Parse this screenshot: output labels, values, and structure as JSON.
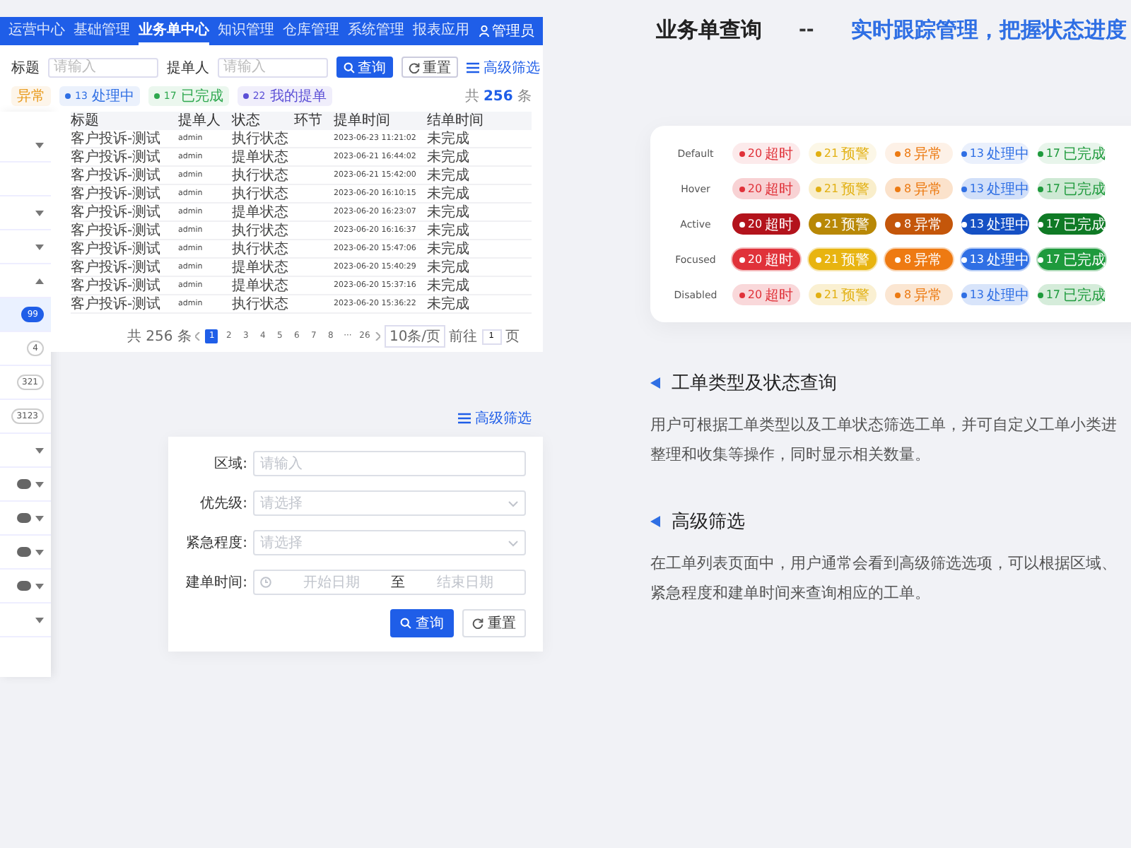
{
  "app": {
    "nav": [
      {
        "label": "运营中心",
        "selected": false
      },
      {
        "label": "基础管理",
        "selected": false
      },
      {
        "label": "业务单中心",
        "selected": true
      },
      {
        "label": "知识管理",
        "selected": false
      },
      {
        "label": "仓库管理",
        "selected": false
      },
      {
        "label": "系统管理",
        "selected": false
      },
      {
        "label": "报表应用",
        "selected": false
      }
    ],
    "user": "管理员",
    "filters": [
      {
        "label": "标题",
        "placeholder": "请输入"
      },
      {
        "label": "提单人",
        "placeholder": "请输入"
      }
    ],
    "search_button": "查询",
    "reset_button": "重置",
    "advanced_link": "高级筛选",
    "status_tabs": [
      {
        "label": "异常",
        "color": "#e89a1c"
      },
      {
        "label": "处理中",
        "count": "13",
        "color": "#2f6fe4"
      },
      {
        "label": "已完成",
        "count": "17",
        "color": "#2fa84f"
      },
      {
        "label": "我的提单",
        "count": "22",
        "color": "#5b4fd6"
      }
    ],
    "total": {
      "prefix": "共",
      "count": "256",
      "suffix": "条"
    },
    "sidebar": [
      {
        "kind": "chevron",
        "expanded": false
      },
      {
        "kind": "plain"
      },
      {
        "kind": "chevron",
        "expanded": false
      },
      {
        "kind": "chevron",
        "expanded": false
      },
      {
        "kind": "chevron",
        "expanded": true
      },
      {
        "kind": "count",
        "badge": "99",
        "selected": true
      },
      {
        "kind": "count",
        "badge": "4",
        "selected": false
      },
      {
        "kind": "count",
        "badge": "321",
        "selected": false
      },
      {
        "kind": "count",
        "badge": "3123",
        "selected": false
      },
      {
        "kind": "chevron",
        "expanded": false
      },
      {
        "kind": "dark",
        "expanded": false
      },
      {
        "kind": "dark",
        "expanded": false
      },
      {
        "kind": "dark",
        "expanded": false
      },
      {
        "kind": "dark",
        "expanded": false
      },
      {
        "kind": "chevron",
        "expanded": false
      }
    ],
    "table": {
      "columns": [
        "标题",
        "提单人",
        "状态",
        "环节",
        "提单时间",
        "结单时间"
      ],
      "rows": [
        [
          "客户投诉-测试",
          "admin",
          "执行状态",
          "",
          "2023-06-23 11:21:02",
          "未完成"
        ],
        [
          "客户投诉-测试",
          "admin",
          "提单状态",
          "",
          "2023-06-21 16:44:02",
          "未完成"
        ],
        [
          "客户投诉-测试",
          "admin",
          "执行状态",
          "",
          "2023-06-21 15:42:00",
          "未完成"
        ],
        [
          "客户投诉-测试",
          "admin",
          "执行状态",
          "",
          "2023-06-20 16:10:15",
          "未完成"
        ],
        [
          "客户投诉-测试",
          "admin",
          "提单状态",
          "",
          "2023-06-20 16:23:07",
          "未完成"
        ],
        [
          "客户投诉-测试",
          "admin",
          "执行状态",
          "",
          "2023-06-20 16:16:37",
          "未完成"
        ],
        [
          "客户投诉-测试",
          "admin",
          "执行状态",
          "",
          "2023-06-20 15:47:06",
          "未完成"
        ],
        [
          "客户投诉-测试",
          "admin",
          "提单状态",
          "",
          "2023-06-20 15:40:29",
          "未完成"
        ],
        [
          "客户投诉-测试",
          "admin",
          "提单状态",
          "",
          "2023-06-20 15:37:16",
          "未完成"
        ],
        [
          "客户投诉-测试",
          "admin",
          "执行状态",
          "",
          "2023-06-20 15:36:22",
          "未完成"
        ]
      ]
    },
    "pagination": {
      "total": "共 256 条",
      "pages": [
        {
          "label": "1",
          "selected": true
        },
        {
          "label": "2",
          "selected": false
        },
        {
          "label": "3",
          "selected": false
        },
        {
          "label": "4",
          "selected": false
        },
        {
          "label": "5",
          "selected": false
        },
        {
          "label": "6",
          "selected": false
        },
        {
          "label": "7",
          "selected": false
        },
        {
          "label": "8",
          "selected": false
        },
        {
          "label": "···",
          "selected": false
        },
        {
          "label": "26",
          "selected": false
        }
      ],
      "size": "10条/页",
      "goto": "前往",
      "page_input": "1",
      "page_unit": "页"
    }
  },
  "filter_panel": {
    "link": "高级筛选",
    "fields": [
      {
        "label": "区域:",
        "kind": "input",
        "placeholder": "请输入"
      },
      {
        "label": "优先级:",
        "kind": "select",
        "placeholder": "请选择"
      },
      {
        "label": "紧急程度:",
        "kind": "select",
        "placeholder": "请选择"
      },
      {
        "label": "建单时间:",
        "kind": "daterange",
        "start": "开始日期",
        "separator": "至",
        "end": "结束日期"
      }
    ],
    "buttons": [
      {
        "label": "查询",
        "kind": "primary"
      },
      {
        "label": "重置",
        "kind": "secondary"
      }
    ]
  },
  "heading": {
    "title": "业务单查询",
    "dash": "--",
    "subtitle": "实时跟踪管理，把握状态进度"
  },
  "states": [
    {
      "label": "Default",
      "kind": "default",
      "tags": [
        {
          "count": "20",
          "label": "超时",
          "color": "#e0323a"
        },
        {
          "count": "21",
          "label": "预警",
          "color": "#e2b012"
        },
        {
          "count": "8",
          "label": "异常",
          "color": "#ec7a12"
        },
        {
          "count": "13",
          "label": "处理中",
          "color": "#2f6fe4"
        },
        {
          "count": "17",
          "label": "已完成",
          "color": "#1e9a3c"
        }
      ]
    },
    {
      "label": "Hover",
      "kind": "hover",
      "tags": [
        {
          "count": "20",
          "label": "超时",
          "color": "#e0323a"
        },
        {
          "count": "21",
          "label": "预警",
          "color": "#e2b012"
        },
        {
          "count": "8",
          "label": "异常",
          "color": "#ec7a12"
        },
        {
          "count": "13",
          "label": "处理中",
          "color": "#2f6fe4"
        },
        {
          "count": "17",
          "label": "已完成",
          "color": "#1e9a3c"
        }
      ]
    },
    {
      "label": "Active",
      "kind": "active",
      "tags": [
        {
          "count": "20",
          "label": "超时",
          "color": "#b3131c"
        },
        {
          "count": "21",
          "label": "预警",
          "color": "#b88806"
        },
        {
          "count": "8",
          "label": "异常",
          "color": "#c4560a"
        },
        {
          "count": "13",
          "label": "处理中",
          "color": "#1550c4"
        },
        {
          "count": "17",
          "label": "已完成",
          "color": "#0f7a25"
        }
      ]
    },
    {
      "label": "Focused",
      "kind": "focused",
      "tags": [
        {
          "count": "20",
          "label": "超时",
          "color": "#e0323a"
        },
        {
          "count": "21",
          "label": "预警",
          "color": "#e8b410"
        },
        {
          "count": "8",
          "label": "异常",
          "color": "#ee7a12"
        },
        {
          "count": "13",
          "label": "处理中",
          "color": "#2f6fe4"
        },
        {
          "count": "17",
          "label": "已完成",
          "color": "#1e9a3c"
        }
      ]
    },
    {
      "label": "Disabled",
      "kind": "disabled",
      "tags": [
        {
          "count": "20",
          "label": "超时",
          "color": "#e0323a"
        },
        {
          "count": "21",
          "label": "预警",
          "color": "#e2b012"
        },
        {
          "count": "8",
          "label": "异常",
          "color": "#ec7a12"
        },
        {
          "count": "13",
          "label": "处理中",
          "color": "#2f6fe4"
        },
        {
          "count": "17",
          "label": "已完成",
          "color": "#1e9a3c"
        }
      ]
    }
  ],
  "sections": [
    {
      "title": "工单类型及状态查询",
      "lines": [
        "用户可根据工单类型以及工单状态筛选工单，并可自定义工单小类进",
        "整理和收集等操作，同时显示相关数量。"
      ]
    },
    {
      "title": "高级筛选",
      "lines": [
        "在工单列表页面中，用户通常会看到高级筛选选项，可以根据区域、",
        "紧急程度和建单时间来查询相应的工单。"
      ]
    }
  ]
}
